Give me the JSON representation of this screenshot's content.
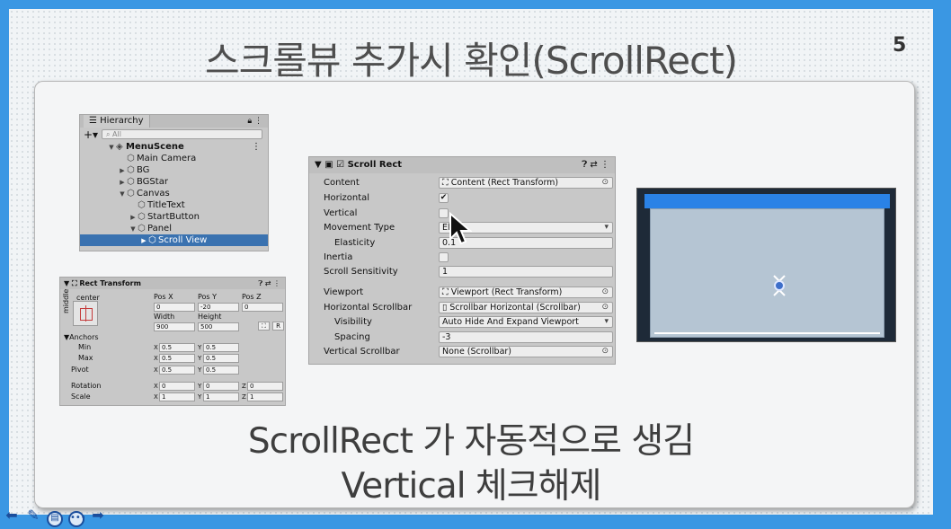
{
  "slide": {
    "title": "스크롤뷰 추가시 확인(ScrollRect)",
    "page_number": "5",
    "caption_line1": "ScrollRect 가 자동적으로 생김",
    "caption_line2": "Vertical 체크해제"
  },
  "hierarchy": {
    "tab_label": "Hierarchy",
    "search_placeholder": "All",
    "items": [
      {
        "label": "MenuScene",
        "depth": 0,
        "expanded": true,
        "icon": "unity-scene-icon",
        "bold": true
      },
      {
        "label": "Main Camera",
        "depth": 1,
        "expanded": null,
        "icon": "gameobject-cube-icon"
      },
      {
        "label": "BG",
        "depth": 1,
        "expanded": false,
        "icon": "gameobject-cube-icon"
      },
      {
        "label": "BGStar",
        "depth": 1,
        "expanded": false,
        "icon": "gameobject-cube-icon"
      },
      {
        "label": "Canvas",
        "depth": 1,
        "expanded": true,
        "icon": "gameobject-cube-icon"
      },
      {
        "label": "TitleText",
        "depth": 2,
        "expanded": null,
        "icon": "gameobject-cube-icon"
      },
      {
        "label": "StartButton",
        "depth": 2,
        "expanded": false,
        "icon": "gameobject-cube-icon"
      },
      {
        "label": "Panel",
        "depth": 2,
        "expanded": true,
        "icon": "gameobject-cube-icon"
      },
      {
        "label": "Scroll View",
        "depth": 3,
        "expanded": false,
        "icon": "gameobject-cube-icon",
        "selected": true
      }
    ]
  },
  "rect_transform": {
    "title": "Rect Transform",
    "anchor_preset_h": "center",
    "anchor_preset_v": "middle",
    "pos_x_label": "Pos X",
    "pos_y_label": "Pos Y",
    "pos_z_label": "Pos Z",
    "pos_x": "0",
    "pos_y": "-20",
    "pos_z": "0",
    "width_label": "Width",
    "height_label": "Height",
    "width": "900",
    "height": "500",
    "raw_button": "R",
    "anchors_label": "Anchors",
    "min_label": "Min",
    "max_label": "Max",
    "pivot_label": "Pivot",
    "rotation_label": "Rotation",
    "scale_label": "Scale",
    "x_axis": "X",
    "y_axis": "Y",
    "z_axis": "Z",
    "anchors_min_x": "0.5",
    "anchors_min_y": "0.5",
    "anchors_max_x": "0.5",
    "anchors_max_y": "0.5",
    "pivot_x": "0.5",
    "pivot_y": "0.5",
    "rotation_x": "0",
    "rotation_y": "0",
    "rotation_z": "0",
    "scale_x": "1",
    "scale_y": "1",
    "scale_z": "1"
  },
  "scroll_rect": {
    "title": "Scroll Rect",
    "enabled": true,
    "rows": {
      "content": {
        "label": "Content",
        "value": "Content (Rect Transform)"
      },
      "horizontal": {
        "label": "Horizontal",
        "checked": true
      },
      "vertical": {
        "label": "Vertical",
        "checked": false
      },
      "movement_type": {
        "label": "Movement Type",
        "value": "Ela"
      },
      "elasticity": {
        "label": "Elasticity",
        "value": "0.1"
      },
      "inertia": {
        "label": "Inertia",
        "checked": false
      },
      "scroll_sensitivity": {
        "label": "Scroll Sensitivity",
        "value": "1"
      },
      "viewport": {
        "label": "Viewport",
        "value": "Viewport (Rect Transform)"
      },
      "horizontal_scrollbar": {
        "label": "Horizontal Scrollbar",
        "value": "Scrollbar Horizontal (Scrollbar)"
      },
      "visibility": {
        "label": "Visibility",
        "value": "Auto Hide And Expand Viewport"
      },
      "spacing": {
        "label": "Spacing",
        "value": "-3"
      },
      "vertical_scrollbar": {
        "label": "Vertical Scrollbar",
        "value": "None (Scrollbar)"
      }
    }
  },
  "colors": {
    "frame_blue": "#3a97e3",
    "selection_blue": "#3a72b0",
    "scene_topbar": "#2a82e6",
    "scene_panel": "#b5c5d3"
  }
}
